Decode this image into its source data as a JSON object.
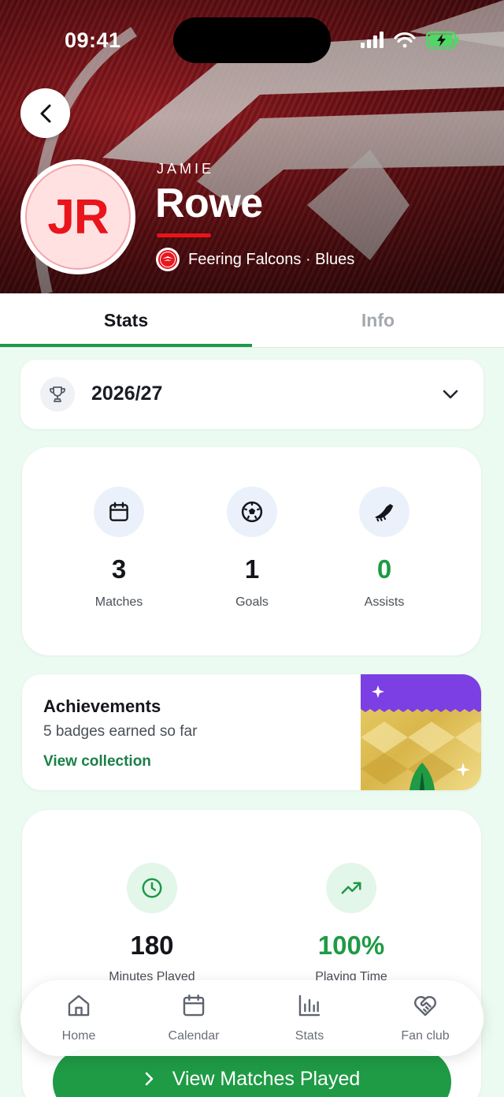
{
  "status_bar": {
    "time": "09:41"
  },
  "player": {
    "initials": "JR",
    "first_name": "JAMIE",
    "last_name": "Rowe",
    "club_team": "Feering Falcons · Blues"
  },
  "tabs": [
    {
      "label": "Stats",
      "active": true
    },
    {
      "label": "Info",
      "active": false
    }
  ],
  "season": {
    "label": "2026/27",
    "icon": "trophy-icon"
  },
  "stats": [
    {
      "value": "3",
      "label": "Matches",
      "icon": "calendar-icon"
    },
    {
      "value": "1",
      "label": "Goals",
      "icon": "football-icon"
    },
    {
      "value": "0",
      "label": "Assists",
      "icon": "boot-icon"
    }
  ],
  "achievements": {
    "title": "Achievements",
    "subtitle": "5 badges earned so far",
    "link": "View collection"
  },
  "time_stats": [
    {
      "value": "180",
      "label": "Minutes Played",
      "icon": "clock-icon"
    },
    {
      "value": "100%",
      "label": "Playing Time",
      "icon": "trending-up-icon"
    }
  ],
  "view_matches": {
    "label": "View Matches Played"
  },
  "tabbar": [
    {
      "label": "Home",
      "icon": "home-icon"
    },
    {
      "label": "Calendar",
      "icon": "calendar-icon"
    },
    {
      "label": "Stats",
      "icon": "bar-chart-icon"
    },
    {
      "label": "Fan club",
      "icon": "heart-handshake-icon"
    }
  ],
  "colors": {
    "accent_green": "#1f9a45",
    "brand_red": "#e8151b",
    "page_background": "#ecfbf1"
  }
}
